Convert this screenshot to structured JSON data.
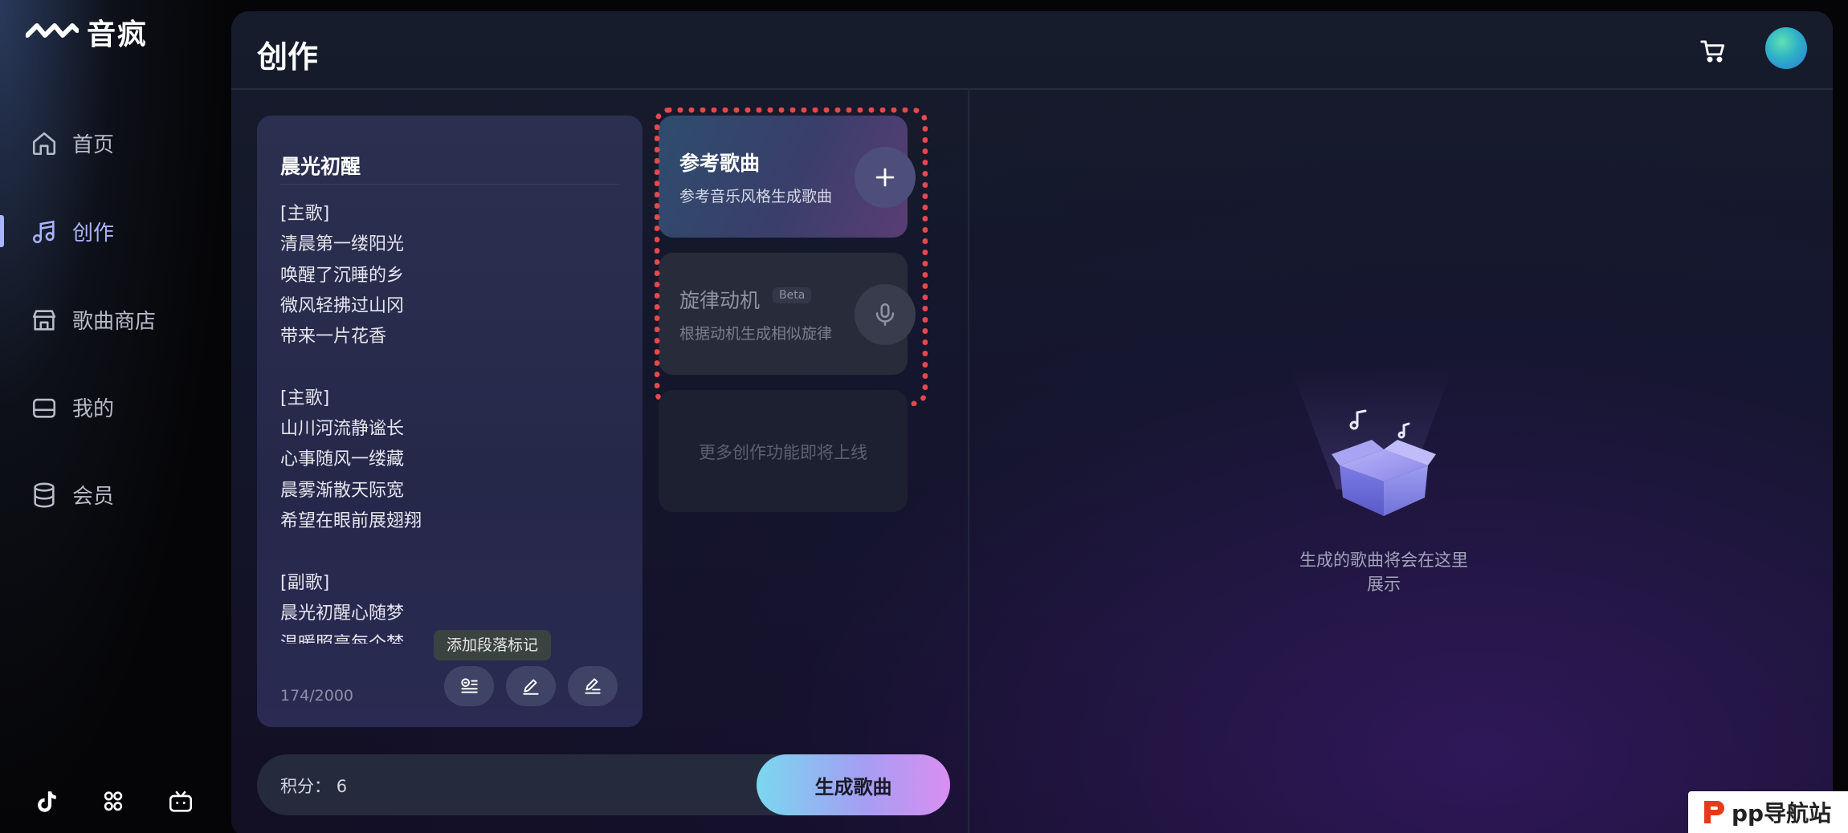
{
  "app": {
    "name": "音疯"
  },
  "sidebar": {
    "items": [
      {
        "label": "首页",
        "icon": "home-icon"
      },
      {
        "label": "创作",
        "icon": "music-note-icon",
        "active": true
      },
      {
        "label": "歌曲商店",
        "icon": "store-icon"
      },
      {
        "label": "我的",
        "icon": "wallet-icon"
      },
      {
        "label": "会员",
        "icon": "database-icon"
      }
    ],
    "bottom_icons": [
      "tiktok-icon",
      "apps-icon",
      "tv-icon"
    ]
  },
  "header": {
    "title": "创作",
    "icons": [
      "cart-icon",
      "avatar"
    ]
  },
  "lyrics": {
    "title": "晨光初醒",
    "lines": [
      "[主歌]",
      "清晨第一缕阳光",
      "唤醒了沉睡的乡",
      "微风轻拂过山冈",
      "带来一片花香",
      "",
      "[主歌]",
      "山川河流静谧长",
      "心事随风一缕藏",
      "晨雾渐散天际宽",
      "希望在眼前展翅翔",
      "",
      "[副歌]",
      "晨光初醒心随梦",
      "温暖照亮每个梦"
    ],
    "char_count": "174/2000",
    "tooltip": "添加段落标记",
    "tools": [
      "paragraph-mark-icon",
      "edit-icon",
      "rewrite-icon"
    ]
  },
  "features": {
    "reference": {
      "title": "参考歌曲",
      "subtitle": "参考音乐风格生成歌曲",
      "button_icon": "plus-icon"
    },
    "melody": {
      "title": "旋律动机",
      "badge": "Beta",
      "subtitle": "根据动机生成相似旋律",
      "button_icon": "microphone-icon"
    },
    "more": {
      "text": "更多创作功能即将上线"
    }
  },
  "empty_state": {
    "text": "生成的歌曲将会在这里展示",
    "icon": "music-box-icon"
  },
  "footer": {
    "points_label": "积分：",
    "points_value": "6",
    "generate_label": "生成歌曲"
  },
  "site_badge": {
    "text": "pp导航站"
  },
  "colors": {
    "accent": "#a9b3ff",
    "highlight_border": "#e8484c",
    "background": "#050507"
  }
}
